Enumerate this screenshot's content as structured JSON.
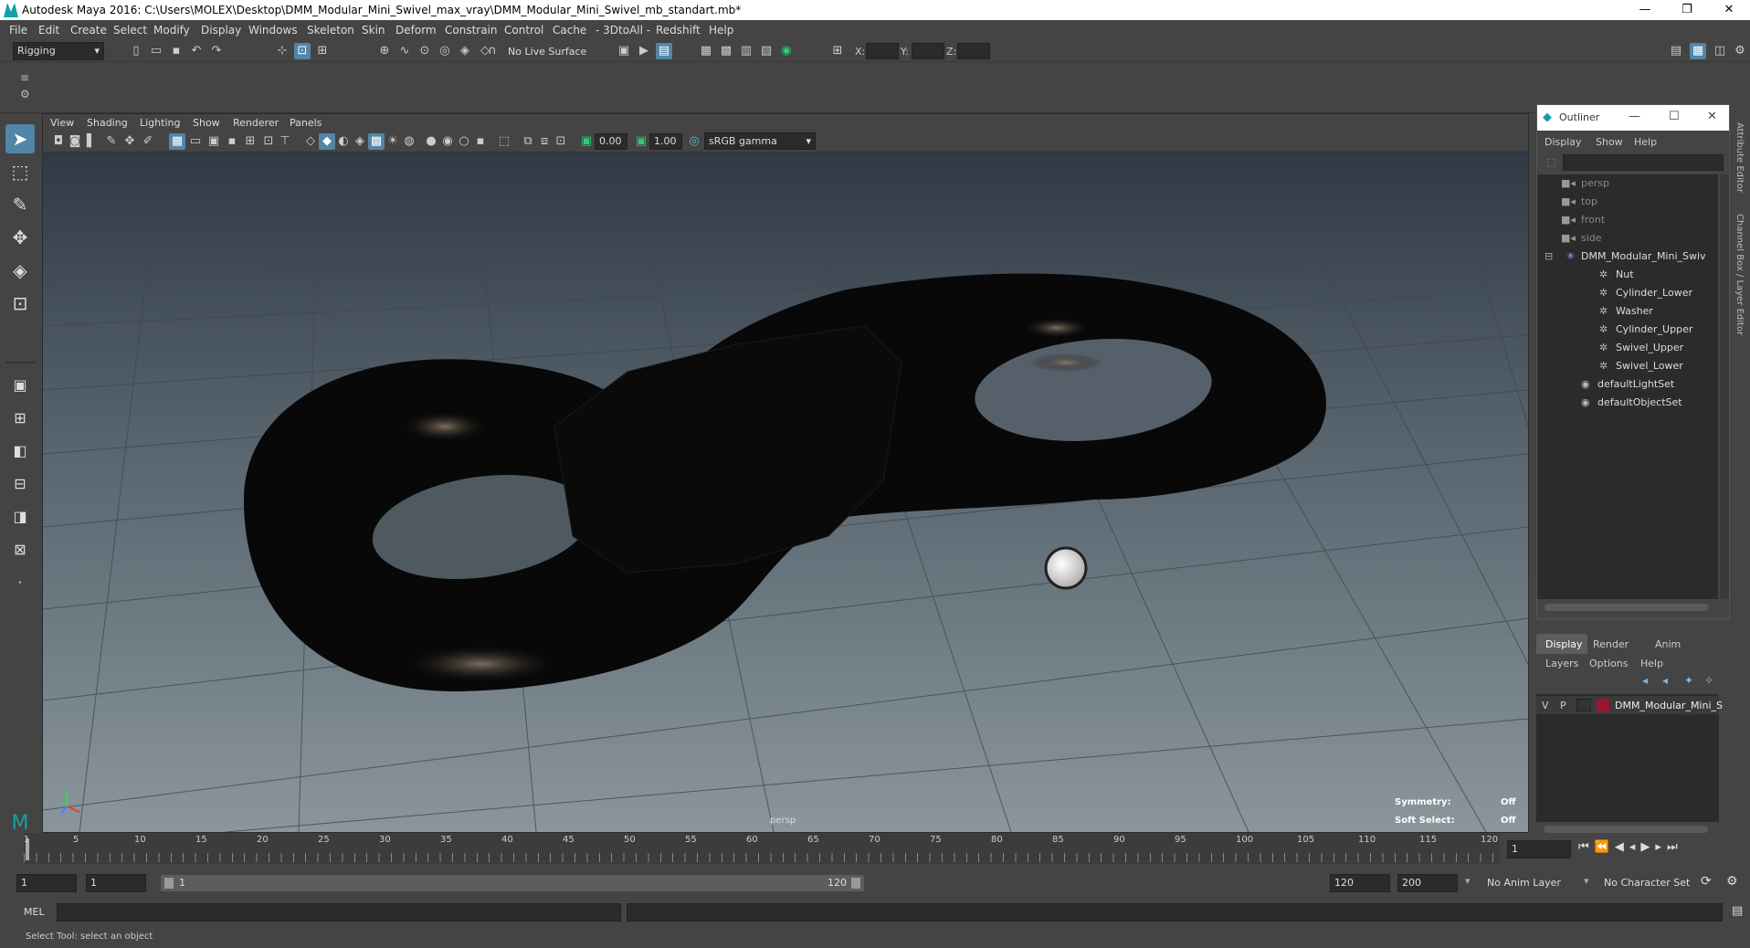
{
  "window": {
    "title": "Autodesk Maya 2016: C:\\Users\\MOLEX\\Desktop\\DMM_Modular_Mini_Swivel_max_vray\\DMM_Modular_Mini_Swivel_mb_standart.mb*",
    "minimize": "—",
    "restore": "❐",
    "close": "✕"
  },
  "menubar": [
    "File",
    "Edit",
    "Create",
    "Select",
    "Modify",
    "Display",
    "Windows",
    "Skeleton",
    "Skin",
    "Deform",
    "Constrain",
    "Control",
    "Cache",
    "- 3DtoAll -",
    "Redshift",
    "Help"
  ],
  "statusline": {
    "menuset": "Rigging",
    "live_surface": "No Live Surface",
    "x_label": "X:",
    "y_label": "Y:",
    "z_label": "Z:"
  },
  "viewport": {
    "menu": [
      "View",
      "Shading",
      "Lighting",
      "Show",
      "Renderer",
      "Panels"
    ],
    "exposure": "0.00",
    "gamma": "1.00",
    "color_space": "sRGB gamma",
    "camera_label": "persp",
    "hud": {
      "symmetry_label": "Symmetry:",
      "symmetry_value": "Off",
      "soft_select_label": "Soft Select:",
      "soft_select_value": "Off"
    }
  },
  "outliner": {
    "title": "Outliner",
    "menu": [
      "Display",
      "Show",
      "Help"
    ],
    "items": [
      {
        "label": "persp",
        "icon": "camera-icon",
        "indent": 0,
        "dim": true
      },
      {
        "label": "top",
        "icon": "camera-icon",
        "indent": 0,
        "dim": true
      },
      {
        "label": "front",
        "icon": "camera-icon",
        "indent": 0,
        "dim": true
      },
      {
        "label": "side",
        "icon": "camera-icon",
        "indent": 0,
        "dim": true
      },
      {
        "label": "DMM_Modular_Mini_Swiv",
        "icon": "group-icon",
        "indent": 0,
        "dim": false
      },
      {
        "label": "Nut",
        "icon": "mesh-icon",
        "indent": 1,
        "dim": false
      },
      {
        "label": "Cylinder_Lower",
        "icon": "mesh-icon",
        "indent": 1,
        "dim": false
      },
      {
        "label": "Washer",
        "icon": "mesh-icon",
        "indent": 1,
        "dim": false
      },
      {
        "label": "Cylinder_Upper",
        "icon": "mesh-icon",
        "indent": 1,
        "dim": false
      },
      {
        "label": "Swivel_Upper",
        "icon": "mesh-icon",
        "indent": 1,
        "dim": false
      },
      {
        "label": "Swivel_Lower",
        "icon": "mesh-icon",
        "indent": 1,
        "dim": false
      },
      {
        "label": "defaultLightSet",
        "icon": "set-icon",
        "indent": 0,
        "dim": false
      },
      {
        "label": "defaultObjectSet",
        "icon": "set-icon",
        "indent": 0,
        "dim": false
      }
    ]
  },
  "layer_editor": {
    "tabs": [
      "Display",
      "Render",
      "Anim"
    ],
    "menu": [
      "Layers",
      "Options",
      "Help"
    ],
    "layer": {
      "v": "V",
      "p": "P",
      "name": "DMM_Modular_Mini_S",
      "color": "#9b1530"
    }
  },
  "side_tabs": [
    "Attribute Editor",
    "Channel Box / Layer Editor"
  ],
  "timeline": {
    "ticks": [
      "1",
      "5",
      "10",
      "15",
      "20",
      "25",
      "30",
      "35",
      "40",
      "45",
      "50",
      "55",
      "60",
      "65",
      "70",
      "75",
      "80",
      "85",
      "90",
      "95",
      "100",
      "105",
      "110",
      "115",
      "120"
    ],
    "current_frame": "1"
  },
  "range": {
    "start": "1",
    "inner_start": "1",
    "slider_start": "1",
    "slider_end": "120",
    "end": "120",
    "anim_end": "200",
    "anim_layer": "No Anim Layer",
    "character_set": "No Character Set"
  },
  "cmdline": {
    "label": "MEL"
  },
  "helpline": {
    "text": "Select Tool: select an object"
  },
  "colors": {
    "accent": "#5285a6",
    "maya_teal": "#14a0a8",
    "layer_red": "#9b1530"
  }
}
